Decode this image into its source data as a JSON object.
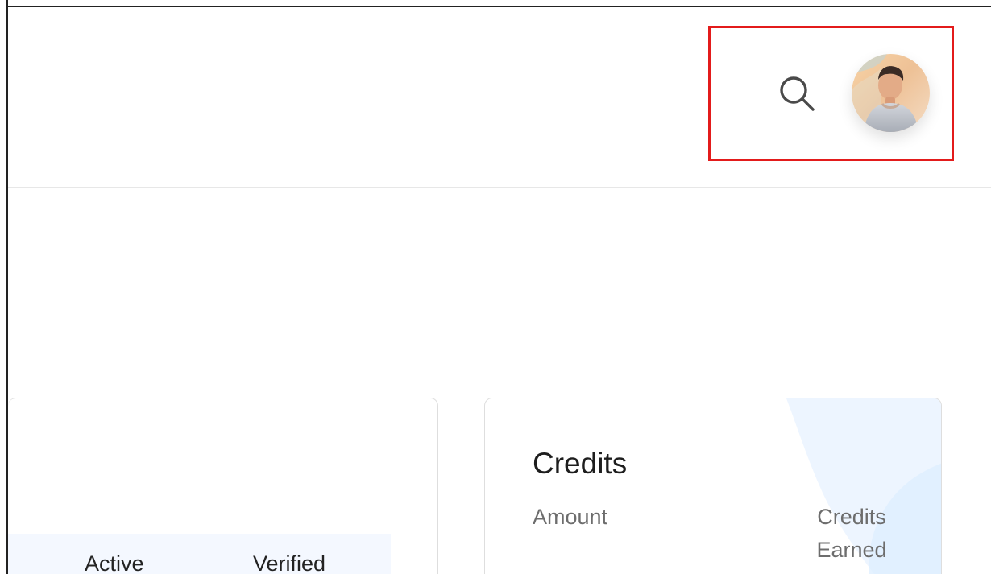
{
  "header": {
    "search_icon": "search-icon",
    "avatar": "user-avatar"
  },
  "table": {
    "columns": [
      "Active",
      "Verified"
    ]
  },
  "credits_card": {
    "title": "Credits",
    "columns": [
      "Amount",
      "Credits Earned"
    ]
  },
  "colors": {
    "highlight": "#e31b1b",
    "table_header_bg": "#f4f8ff",
    "card_border": "#dedede",
    "decor_blue": "#eaf3ff"
  }
}
